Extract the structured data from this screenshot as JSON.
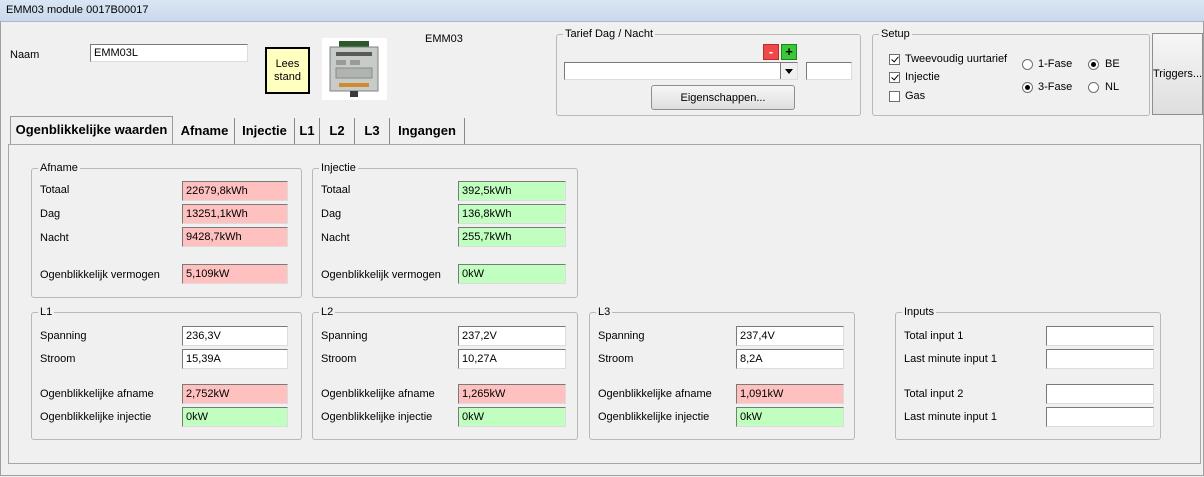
{
  "window": {
    "title": "EMM03 module 0017B00017"
  },
  "header": {
    "naam_label": "Naam",
    "naam_value": "EMM03L",
    "lees_stand_button": "Lees stand",
    "module_label": "EMM03"
  },
  "tarief": {
    "legend": "Tarief Dag / Nacht",
    "minus": "-",
    "plus": "+",
    "select_value": "",
    "small_value": "",
    "eigenschappen_button": "Eigenschappen..."
  },
  "setup": {
    "legend": "Setup",
    "tweevoudig": {
      "label": "Tweevoudig uurtarief",
      "checked": true
    },
    "injectie": {
      "label": "Injectie",
      "checked": true
    },
    "gas": {
      "label": "Gas",
      "checked": false
    },
    "fase1": {
      "label": "1-Fase",
      "selected": false
    },
    "fase3": {
      "label": "3-Fase",
      "selected": true
    },
    "be": {
      "label": "BE",
      "selected": true
    },
    "nl": {
      "label": "NL",
      "selected": false
    }
  },
  "triggers_button": "Triggers...",
  "tabs": [
    {
      "label": "Ogenblikkelijke waarden",
      "active": true
    },
    {
      "label": "Afname"
    },
    {
      "label": "Injectie"
    },
    {
      "label": "L1"
    },
    {
      "label": "L2"
    },
    {
      "label": "L3"
    },
    {
      "label": "Ingangen"
    }
  ],
  "afname": {
    "legend": "Afname",
    "totaal_label": "Totaal",
    "totaal": "22679,8kWh",
    "dag_label": "Dag",
    "dag": "13251,1kWh",
    "nacht_label": "Nacht",
    "nacht": "9428,7kWh",
    "vermogen_label": "Ogenblikkelijk vermogen",
    "vermogen": "5,109kW"
  },
  "injectie": {
    "legend": "Injectie",
    "totaal_label": "Totaal",
    "totaal": "392,5kWh",
    "dag_label": "Dag",
    "dag": "136,8kWh",
    "nacht_label": "Nacht",
    "nacht": "255,7kWh",
    "vermogen_label": "Ogenblikkelijk vermogen",
    "vermogen": "0kW"
  },
  "l1": {
    "legend": "L1",
    "spanning_label": "Spanning",
    "spanning": "236,3V",
    "stroom_label": "Stroom",
    "stroom": "15,39A",
    "afname_label": "Ogenblikkelijke afname",
    "afname": "2,752kW",
    "injectie_label": "Ogenblikkelijke injectie",
    "injectie": "0kW"
  },
  "l2": {
    "legend": "L2",
    "spanning_label": "Spanning",
    "spanning": "237,2V",
    "stroom_label": "Stroom",
    "stroom": "10,27A",
    "afname_label": "Ogenblikkelijke afname",
    "afname": "1,265kW",
    "injectie_label": "Ogenblikkelijke injectie",
    "injectie": "0kW"
  },
  "l3": {
    "legend": "L3",
    "spanning_label": "Spanning",
    "spanning": "237,4V",
    "stroom_label": "Stroom",
    "stroom": "8,2A",
    "afname_label": "Ogenblikkelijke afname",
    "afname": "1,091kW",
    "injectie_label": "Ogenblikkelijke injectie",
    "injectie": "0kW"
  },
  "inputs": {
    "legend": "Inputs",
    "total1_label": "Total input 1",
    "total1": "",
    "last1_label": "Last minute input 1",
    "last1": "",
    "total2_label": "Total input 2",
    "total2": "",
    "last2_label": "Last minute input 1",
    "last2": ""
  }
}
